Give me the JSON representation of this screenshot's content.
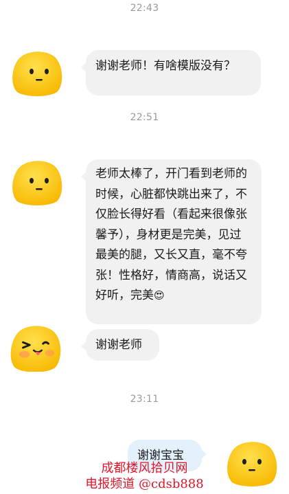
{
  "messages": [
    {
      "type": "timestamp",
      "text": "22:43"
    },
    {
      "type": "incoming",
      "text": "谢谢老师！有啥模版没有？"
    },
    {
      "type": "timestamp",
      "text": "22:51"
    },
    {
      "type": "incoming",
      "text": "老师太棒了，开门看到老师的时候，心脏都快跳出来了，不仅脸长得好看（看起来很像张馨予），身材更是完美，见过最美的腿，又长又直，毫不夸张！性格好，情商高，说话又好听，完美",
      "emoji": "😍"
    },
    {
      "type": "incoming",
      "text": "谢谢老师"
    },
    {
      "type": "timestamp",
      "text": "23:11"
    },
    {
      "type": "outgoing",
      "text": "谢谢宝宝"
    }
  ],
  "watermark": {
    "line1": "成都楼风拾贝网",
    "line2": "电报频道 @cdsb888"
  },
  "colors": {
    "incoming_bubble": "#f1f1f2",
    "outgoing_bubble": "#e3f1fb",
    "avatar_yellow": "#ffcc00",
    "watermark_red": "#e0162b"
  }
}
